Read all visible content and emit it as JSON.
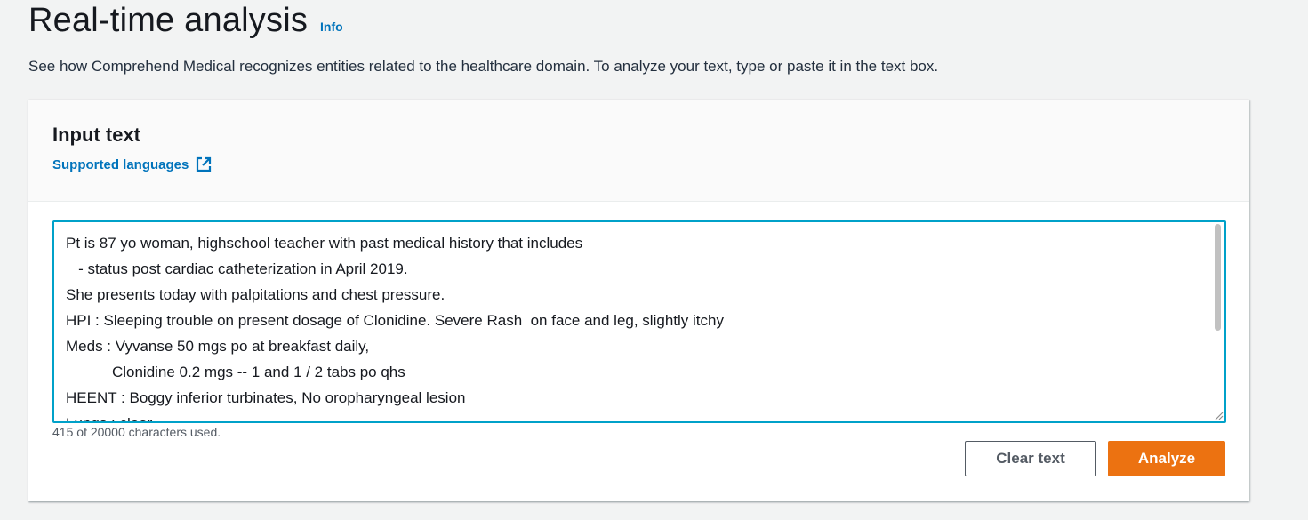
{
  "header": {
    "title": "Real-time analysis",
    "info_label": "Info",
    "description": "See how Comprehend Medical recognizes entities related to the healthcare domain. To analyze your text, type or paste it in the text box."
  },
  "input_panel": {
    "title": "Input text",
    "supported_languages_label": "Supported languages",
    "link_icon": "external-link-icon",
    "text_lines": [
      "Pt is 87 yo woman, highschool teacher with past medical history that includes",
      "   - status post cardiac catheterization in April 2019.",
      "She presents today with palpitations and chest pressure.",
      "HPI : Sleeping trouble on present dosage of Clonidine. Severe Rash  on face and leg, slightly itchy",
      "Meds : Vyvanse 50 mgs po at breakfast daily,",
      "           Clonidine 0.2 mgs -- 1 and 1 / 2 tabs po qhs",
      "HEENT : Boggy inferior turbinates, No oropharyngeal lesion",
      "Lungs : clear"
    ],
    "char_count": "415 of 20000 characters used.",
    "clear_label": "Clear text",
    "analyze_label": "Analyze"
  },
  "colors": {
    "link": "#0073bb",
    "primary_button": "#ec7211",
    "focus_border": "#00a1c9",
    "spellcheck_underline": "#d13212"
  }
}
